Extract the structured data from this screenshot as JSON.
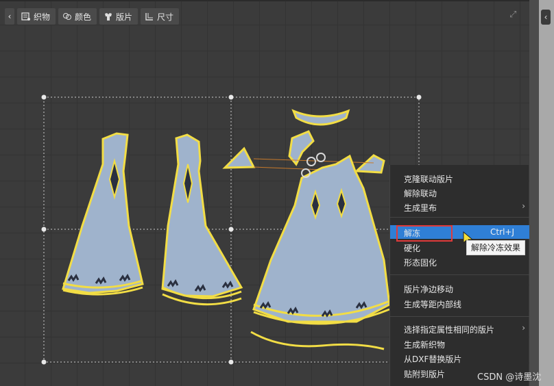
{
  "toolbar": {
    "collapse_glyph": "‹",
    "buttons": [
      {
        "label": "织物",
        "icon": "fabric-icon"
      },
      {
        "label": "颜色",
        "icon": "color-icon"
      },
      {
        "label": "版片",
        "icon": "pattern-icon"
      },
      {
        "label": "尺寸",
        "icon": "size-icon"
      }
    ],
    "expand_glyph": "⤢"
  },
  "right_panel": {
    "collapse_glyph": "‹"
  },
  "context_menu": {
    "items": [
      {
        "label": "克隆联动版片"
      },
      {
        "label": "解除联动"
      },
      {
        "label": "生成里布",
        "submenu": true
      },
      {
        "label": "解冻",
        "shortcut": "Ctrl+J",
        "highlighted": true
      },
      {
        "label": "硬化"
      },
      {
        "label": "形态固化"
      },
      {
        "label": "版片净边移动"
      },
      {
        "label": "生成等距内部线"
      },
      {
        "label": "选择指定属性相同的版片",
        "submenu": true
      },
      {
        "label": "生成新织物"
      },
      {
        "label": "从DXF替换版片"
      },
      {
        "label": "贴附到版片"
      }
    ],
    "submenu_glyph": "›"
  },
  "tooltip": "解除冷冻效果",
  "watermark": "CSDN @诗墨沈",
  "colors": {
    "piece_fill": "#9fb3cc",
    "piece_outline": "#f2dd45",
    "bbox_dots": "#cfcfcf",
    "menu_highlight": "#2f7fd6",
    "annotation_box": "#e03a3a"
  }
}
